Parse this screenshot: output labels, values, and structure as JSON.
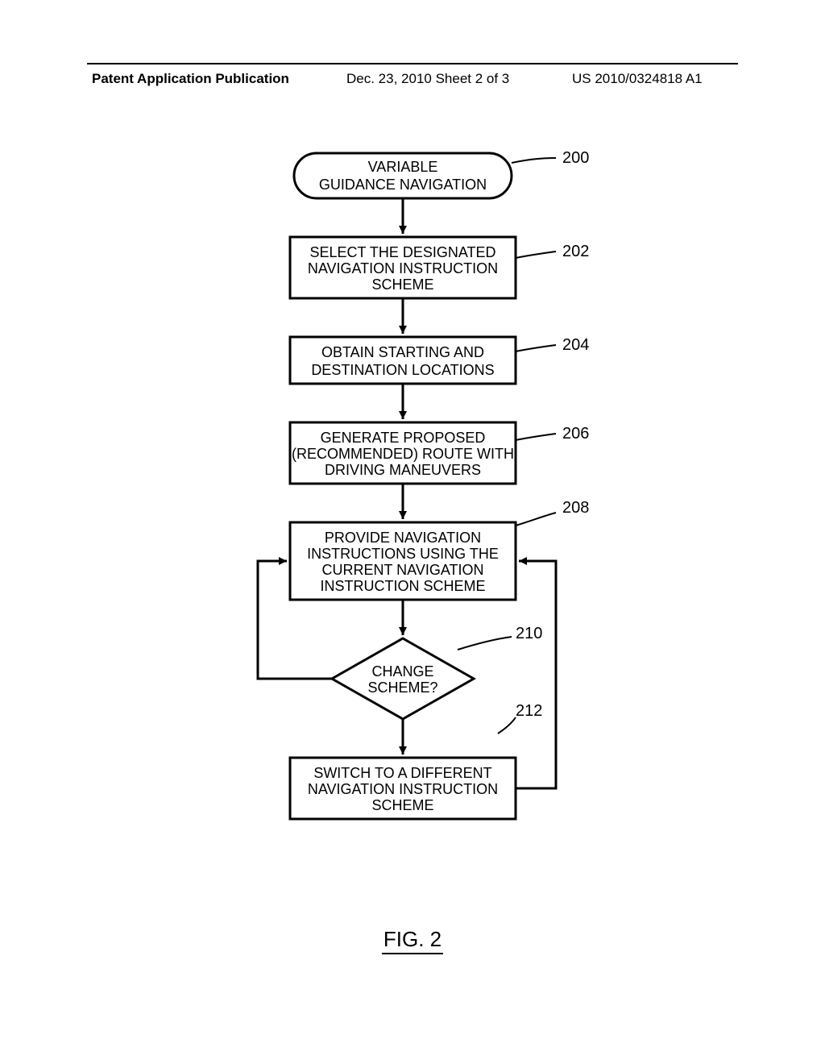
{
  "header": {
    "left": "Patent Application Publication",
    "mid": "Dec. 23, 2010  Sheet 2 of 3",
    "right": "US 2010/0324818 A1"
  },
  "figure_label": "FIG. 2",
  "nodes": {
    "start": {
      "ref": "200",
      "lines": [
        "VARIABLE",
        "GUIDANCE NAVIGATION"
      ]
    },
    "n202": {
      "ref": "202",
      "lines": [
        "SELECT THE DESIGNATED",
        "NAVIGATION INSTRUCTION",
        "SCHEME"
      ]
    },
    "n204": {
      "ref": "204",
      "lines": [
        "OBTAIN STARTING AND",
        "DESTINATION LOCATIONS"
      ]
    },
    "n206": {
      "ref": "206",
      "lines": [
        "GENERATE PROPOSED",
        "(RECOMMENDED) ROUTE WITH",
        "DRIVING MANEUVERS"
      ]
    },
    "n208": {
      "ref": "208",
      "lines": [
        "PROVIDE NAVIGATION",
        "INSTRUCTIONS USING THE",
        "CURRENT NAVIGATION",
        "INSTRUCTION SCHEME"
      ]
    },
    "dec210": {
      "ref": "210",
      "lines": [
        "CHANGE",
        "SCHEME?"
      ]
    },
    "n212": {
      "ref": "212",
      "lines": [
        "SWITCH TO A DIFFERENT",
        "NAVIGATION INSTRUCTION",
        "SCHEME"
      ]
    }
  }
}
